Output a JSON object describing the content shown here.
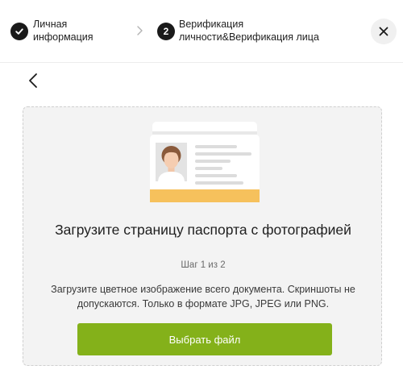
{
  "stepper": {
    "steps": [
      {
        "state": "completed",
        "label": "Личная информация"
      },
      {
        "state": "active",
        "number": "2",
        "label": "Верификация личности&Верификация лица"
      }
    ],
    "separator_icon": "chevron-right-icon",
    "close_icon": "close-icon"
  },
  "navigation": {
    "back_icon": "chevron-left-icon"
  },
  "upload": {
    "illustration": "passport-photo-page-illustration",
    "title": "Загрузите страницу паспорта с фотографией",
    "step_counter": "Шаг 1 из 2",
    "instructions": "Загрузите цветное изображение всего документа. Скриншоты не допускаются. Только в формате JPG, JPEG или PNG.",
    "button_label": "Выбрать файл"
  },
  "colors": {
    "accent": "#84b11a",
    "step_circle": "#1a1a1a",
    "card_background": "#f3f3f3",
    "card_border": "#cfcfcf",
    "passport_stripe": "#f6c15c"
  }
}
